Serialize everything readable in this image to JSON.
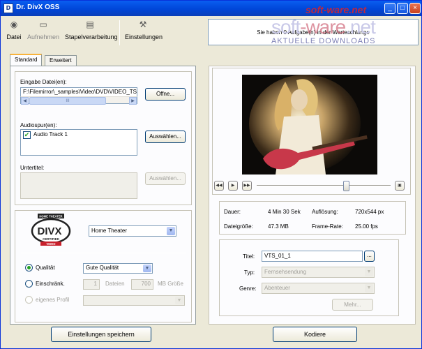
{
  "window": {
    "title": "Dr. DivX OSS",
    "app_icon": "divx-app-icon",
    "minimize": "_",
    "maximize": "□",
    "close": "×"
  },
  "toolbar": {
    "items": [
      {
        "label": "Datei",
        "icon": "disc-icon"
      },
      {
        "label": "Aufnehmen",
        "icon": "record-icon"
      },
      {
        "label": "Stapelverarbeitung",
        "icon": "batch-icon"
      },
      {
        "label": "Einstellungen",
        "icon": "wrench-icon"
      }
    ]
  },
  "message": "Sie haben 0 Aufgabe(n) in der Warteschlange",
  "watermark": {
    "line1": "soft-ware.net",
    "line2_a": "soft",
    "line2_b": "-ware",
    "line2_c": ".net",
    "line3": "AKTUELLE DOWNLOADS"
  },
  "tabs": [
    {
      "label": "Standard",
      "active": true
    },
    {
      "label": "Erweitert",
      "active": false
    }
  ],
  "input": {
    "label": "Eingabe Datei(en):",
    "path": "F:\\Filemirror\\_samples\\Video\\DVD\\VIDEO_TS\\",
    "open_button": "Öffne...",
    "scroll_mid": "III"
  },
  "audio": {
    "label": "Audiospur(en):",
    "tracks": [
      "Audio Track 1"
    ],
    "select_button": "Auswählen..."
  },
  "subtitle": {
    "label": "Untertitel:",
    "select_button": "Auswählen..."
  },
  "profile": {
    "logo_top": "HOME THEATER",
    "logo_main": "DIVX",
    "logo_sub": "CERTIFIED",
    "logo_bottom": "VIDEO",
    "selected": "Home Theater"
  },
  "quality": {
    "quality_label": "Qualität",
    "quality_value": "Gute Qualität",
    "limit_label": "Einschränk.",
    "files_value": "1",
    "files_label": "Dateien",
    "size_value": "700",
    "size_label": "MB Größe",
    "own_profile_label": "eigenes Profil",
    "selected": "quality"
  },
  "save_button": "Einstellungen speichern",
  "player": {
    "position_fraction": 0.67
  },
  "info": {
    "duration_label": "Dauer:",
    "duration_value": "4 Min 30 Sek",
    "resolution_label": "Auflösung:",
    "resolution_value": "720x544 px",
    "filesize_label": "Dateigröße:",
    "filesize_value": "47.3 MB",
    "framerate_label": "Frame-Rate:",
    "framerate_value": "25.00 fps"
  },
  "meta": {
    "title_label": "Titel:",
    "title_value": "VTS_01_1",
    "title_browse": "...",
    "type_label": "Typ:",
    "type_value": "Fernsehsendung",
    "genre_label": "Genre:",
    "genre_value": "Abenteuer",
    "more_button": "Mehr..."
  },
  "encode_button": "Kodiere",
  "colors": {
    "titlebar": "#0046d8",
    "accent_tab": "#f8b33b",
    "watermark_red": "#c0283c"
  }
}
